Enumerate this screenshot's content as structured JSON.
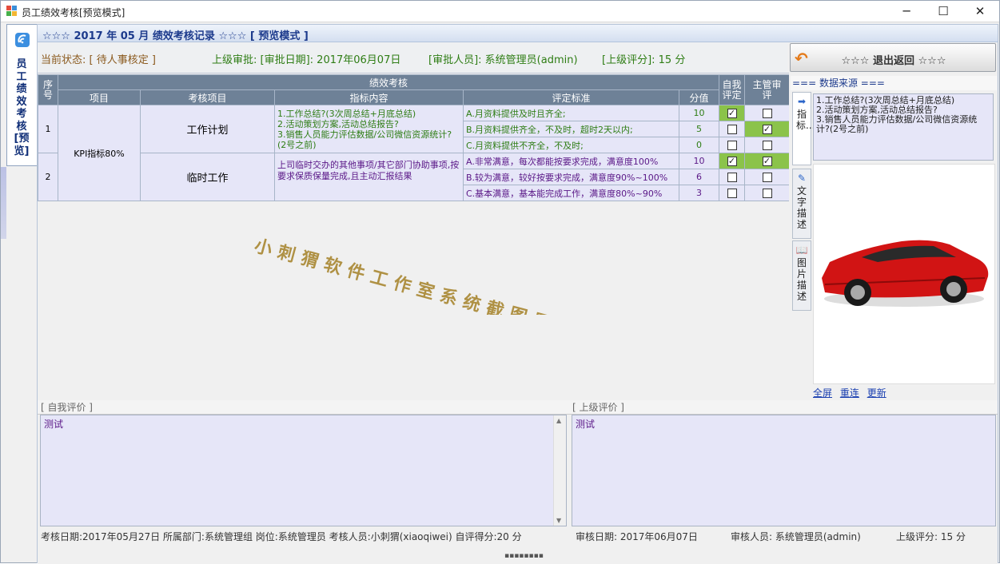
{
  "window": {
    "title": "员工绩效考核[预览模式]"
  },
  "left_tab": {
    "label": "员工绩效考核[预览]"
  },
  "header": {
    "title": "☆☆☆ 2017 年 05 月 绩效考核记录 ☆☆☆ [ 预览模式 ]"
  },
  "status": {
    "current": "当前状态: [ 待人事核定 ]",
    "approval": "上级审批: [审批日期]: 2017年06月07日",
    "approver": "[审批人员]: 系统管理员(admin)",
    "superior_score": "[上级评分]: 15 分"
  },
  "grid": {
    "headers": {
      "index": "序号",
      "group": "绩效考核",
      "project": "项目",
      "item": "考核项目",
      "content": "指标内容",
      "criteria": "评定标准",
      "score": "分值",
      "self_eval": "自我评定",
      "mgr_eval": "主管审评"
    },
    "project_name": "KPI指标80%",
    "rows": [
      {
        "index": "1",
        "item": "工作计划",
        "content": "1.工作总结?(3次周总结+月底总结)\n2.活动策划方案,活动总结报告?\n3.销售人员能力评估数据/公司微信资源统计?(2号之前)",
        "criteria": [
          {
            "text": "A.月资料提供及时且齐全;",
            "score": "10",
            "self": true,
            "mgr": false
          },
          {
            "text": "B.月资料提供齐全，不及时，超时2天以内;",
            "score": "5",
            "self": false,
            "mgr": true
          },
          {
            "text": "C.月资料提供不齐全，不及时;",
            "score": "0",
            "self": false,
            "mgr": false
          }
        ]
      },
      {
        "index": "2",
        "item": "临时工作",
        "content": "上司临时交办的其他事项/其它部门协助事项,按要求保质保量完成,且主动汇报结果",
        "criteria": [
          {
            "text": "A.非常满意，每次都能按要求完成，满意度100%",
            "score": "10",
            "self": true,
            "mgr": true
          },
          {
            "text": "B.较为满意，较好按要求完成，满意度90%~100%",
            "score": "6",
            "self": false,
            "mgr": false
          },
          {
            "text": "C.基本满意，基本能完成工作，满意度80%~90%",
            "score": "3",
            "self": false,
            "mgr": false
          }
        ]
      }
    ]
  },
  "watermark": "小刺猬软件工作室系统截图展示",
  "self_eval": {
    "label": "[ 自我评价 ]",
    "text": "测试",
    "footer": "考核日期:2017年05月27日  所属部门:系统管理组  岗位:系统管理员  考核人员:小刺猬(xiaoqiwei) 自评得分:20 分"
  },
  "superior_eval": {
    "label": "[ 上级评价 ]",
    "text": "测试",
    "footer_date": "审核日期: 2017年06月07日",
    "footer_person": "审核人员: 系统管理员(admin)",
    "footer_score": "上级评分: 15 分"
  },
  "right_panel": {
    "back_label": "☆☆☆ 退出返回 ☆☆☆",
    "source_header": "=== 数据来源 ===",
    "tabs": [
      "指标...",
      "文字描述",
      "图片描述"
    ],
    "source_text": "1.工作总结?(3次周总结+月底总结)\n2.活动策划方案,活动总结报告?\n3.销售人员能力评估数据/公司微信资源统计?(2号之前)",
    "links": [
      "全屏",
      "重连",
      "更新"
    ]
  },
  "colors": {
    "header_text": "#1c3a8c",
    "grid_header": "#6e8197",
    "cell_bg": "#e6e6f8",
    "green_text": "#2e7d14",
    "purple_text": "#5a1787",
    "checked_bg": "#8bc34a",
    "watermark": "#a07a1a"
  }
}
